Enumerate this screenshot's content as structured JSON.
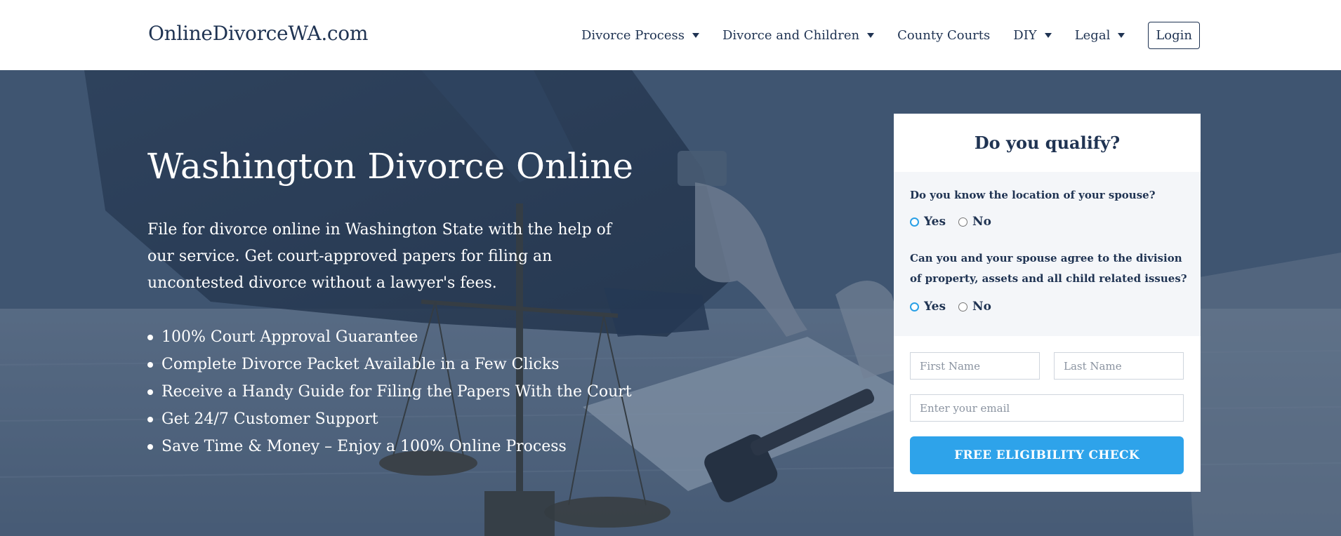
{
  "header": {
    "logo": "OnlineDivorceWA.com",
    "nav": [
      {
        "label": "Divorce Process",
        "has_dropdown": true
      },
      {
        "label": "Divorce and Children",
        "has_dropdown": true
      },
      {
        "label": "County Courts",
        "has_dropdown": false
      },
      {
        "label": "DIY",
        "has_dropdown": true
      },
      {
        "label": "Legal",
        "has_dropdown": true
      }
    ],
    "login_label": "Login"
  },
  "hero": {
    "title": "Washington Divorce Online",
    "description": "File for divorce online in Washington State with the help of our service. Get court-approved papers for filing an uncontested divorce without a lawyer's fees.",
    "features": [
      "100% Court Approval Guarantee",
      "Complete Divorce Packet Available in a Few Clicks",
      "Receive a Handy Guide for Filing the Papers With the Court",
      "Get 24/7 Customer Support",
      "Save Time & Money – Enjoy a 100% Online Process"
    ]
  },
  "form": {
    "title": "Do you qualify?",
    "questions": [
      {
        "text": "Do you know the location of your spouse?",
        "yes": "Yes",
        "no": "No",
        "selected": "Yes"
      },
      {
        "text": "Can you and your spouse agree to the division of property, assets and all child related issues?",
        "yes": "Yes",
        "no": "No",
        "selected": "Yes"
      }
    ],
    "first_name_placeholder": "First Name",
    "last_name_placeholder": "Last Name",
    "email_placeholder": "Enter your email",
    "submit_label": "FREE ELIGIBILITY CHECK"
  },
  "colors": {
    "navy": "#1f3352",
    "hero_overlay": "#405874",
    "accent_blue": "#2ea3ea",
    "panel_gray": "#f4f6f9"
  },
  "icons": {
    "nav_dropdown": "caret-down-icon",
    "feature_bullet": "bullet-dot-icon"
  }
}
